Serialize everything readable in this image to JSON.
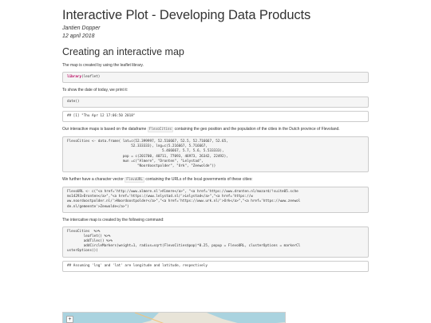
{
  "header": {
    "title": "Interactive Plot - Developing Data Products",
    "author": "Jantien Dopper",
    "date": "12 april 2018"
  },
  "section": {
    "heading": "Creating an interactive map",
    "p1": "The map is created by using the leaflet library.",
    "code1_kw": "library",
    "code1_rest": "(leaflet)",
    "p2": "To show the date of today, we print it:",
    "code2": "date()",
    "out2": "## [1] \"Thu Apr 12 17:06:50 2018\"",
    "p3_a": "Our interactive maps is based on the dataframe",
    "p3_inline": "FlevoCities",
    "p3_b": "containing the geo position and the population of the cities in the Dutch province of Flevoland.",
    "code3": [
      "FlevoCities <- data.frame( lat=c(52.399997, 52.516667, 52.5, 52.716667, 52.65,",
      "                               52.333333), lng=c(5.216667, 5.716667,",
      "                                              5.466667, 5.7, 5.6, 5.533333),",
      "                           pop = c(201700, 40711, 77093, 46973, 26342, 22492),",
      "                           mun =c(\"Almere\", \"Dronten\", \"Lelystad\",",
      "                                  \"Noordoostpolder\", \"Urk\", \"Zeewolde\"))"
    ],
    "p4_a": "We further have a character vector",
    "p4_inline": "FlevoURL",
    "p4_b": "containing the URLs of the local governments of these cities:",
    "code4": [
      "FlevoURL <- c(\"<a href='http://www.almere.nl'>Almere</a>\", \"<a href='https://www.dronten.nl/mozard/!suite05.sche",
      "ms14293>Dronten</a>\",\"<a href='https://www.lelystad.nl/'>Lelystad</a>\",\"<a href='https://w",
      "ww.noordoostpolder.nl/'>Noordoostpolder</a>\",\"<a href='https://www.urk.nl/'>Urk</a>\",\"<a href='https://www.zeewol",
      "de.nl/gemeente'>Zeewolde</a>\")"
    ],
    "p5": "The intercative map is created by the following command:",
    "code5": [
      "FlevoCities  %>%",
      "        leaflet() %>%",
      "        addTiles() %>%",
      "        addCircleMarkers(weight=1, radius=sqrt(FlevoCities$pop)*0.25, popup = FlevoURL, clusterOptions = markerCl",
      "usterOptions())"
    ],
    "out5": "## Assuming 'lng' and 'lat' are longitude and latitude, respectively"
  },
  "map": {
    "zoom_in": "+",
    "land_color": "#e8e4d8",
    "water_color": "#aad3df"
  }
}
